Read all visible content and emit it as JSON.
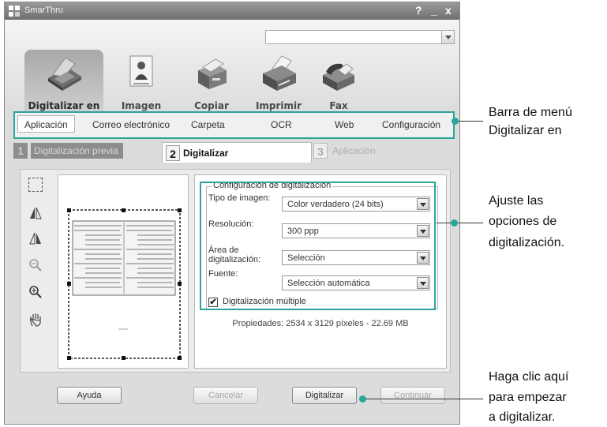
{
  "window": {
    "title": "SmarThru",
    "help_glyph": "?",
    "min_glyph": "_",
    "close_glyph": "x"
  },
  "nav": [
    {
      "label": "Digitalizar en",
      "icon": "scanner-icon"
    },
    {
      "label": "Imagen",
      "icon": "image-icon"
    },
    {
      "label": "Copiar",
      "icon": "copier-icon"
    },
    {
      "label": "Imprimir",
      "icon": "printer-icon"
    },
    {
      "label": "Fax",
      "icon": "fax-icon"
    }
  ],
  "menu": [
    "Aplicación",
    "Correo electrónico",
    "Carpeta",
    "OCR",
    "Web",
    "Configuración"
  ],
  "steps": [
    {
      "num": "1",
      "label": "Digitalización previa"
    },
    {
      "num": "2",
      "label": "Digitalizar"
    },
    {
      "num": "3",
      "label": "Aplicación"
    }
  ],
  "settings": {
    "legend": "Configuración de digitalización",
    "image_type_label": "Tipo de imagen:",
    "image_type_value": "Color verdadero (24 bits)",
    "resolution_label": "Resolución:",
    "resolution_value": "300 ppp",
    "area_label_1": "Área de",
    "area_label_2": "digitalización:",
    "area_value": "Selección",
    "source_label": "Fuente:",
    "source_value": "Selección automática",
    "multi_label": "Digitalización múltiple",
    "multi_checked": "✔"
  },
  "properties": "Propiedades: 2534 x 3129 píxeles - 22.69 MB",
  "buttons": {
    "help": "Ayuda",
    "cancel": "Cancelar",
    "scan": "Digitalizar",
    "continue": "Continuar"
  },
  "annotations": {
    "menu_1": "Barra de menú",
    "menu_2": "Digitalizar en",
    "opts_1": "Ajuste las",
    "opts_2": "opciones de",
    "opts_3": "digitalización.",
    "click_1": "Haga clic aquí",
    "click_2": "para empezar",
    "click_3": "a digitalizar."
  },
  "colors": {
    "accent": "#2aa59a",
    "titlebar": "#7f7f7f"
  }
}
